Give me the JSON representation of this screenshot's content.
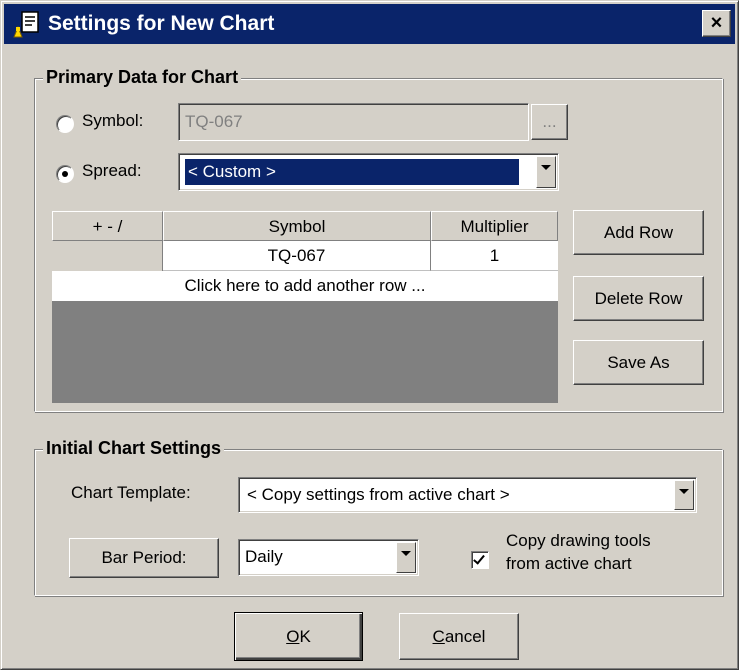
{
  "window": {
    "title": "Settings for New Chart",
    "close_glyph": "×",
    "icon": "chart-settings-icon"
  },
  "primary_group": {
    "title": "Primary Data for Chart",
    "symbol_label": "Symbol:",
    "symbol_value": "TQ-067",
    "browse_label": "...",
    "spread_label": "Spread:",
    "spread_value": "< Custom >",
    "selected_option": "spread"
  },
  "spread_table": {
    "columns": [
      "+ - /",
      "Symbol",
      "Multiplier"
    ],
    "rows": [
      {
        "op": "",
        "symbol": "TQ-067",
        "multiplier": "1"
      }
    ],
    "add_row_prompt": "Click here to add another row ..."
  },
  "side_buttons": {
    "add_row": "Add Row",
    "delete_row": "Delete Row",
    "save_as": "Save As"
  },
  "initial_group": {
    "title": "Initial Chart Settings",
    "template_label": "Chart Template:",
    "template_value": "< Copy settings from active chart >",
    "bar_period_button": "Bar Period:",
    "bar_period_value": "Daily",
    "copy_tools_line1": "Copy drawing tools",
    "copy_tools_line2": "from active chart",
    "copy_tools_checked": true
  },
  "footer": {
    "ok_label_mnemonic": "O",
    "ok_label_rest": "K",
    "cancel_label_mnemonic": "C",
    "cancel_label_rest": "ancel"
  },
  "colors": {
    "titlebar": "#0a246a",
    "dialog_face": "#d4d0c8",
    "selection": "#0a246a",
    "grid_empty": "#808080"
  }
}
